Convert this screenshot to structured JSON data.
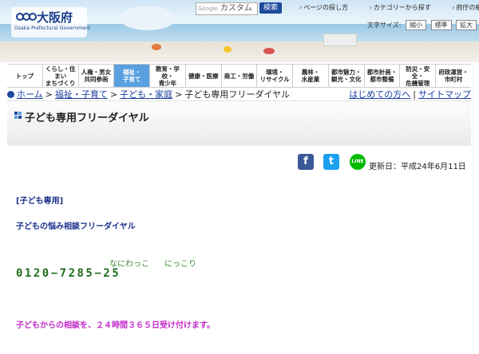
{
  "header": {
    "logo_title": "大阪府",
    "logo_subtitle": "Osaka Prefectural Government",
    "search": {
      "google_label": "Google",
      "placeholder": "カスタム",
      "button": "検索"
    },
    "util_links": [
      "ページの探し方",
      "カテゴリーから探す",
      "府庁の組織から探す"
    ],
    "font_size": {
      "label": "文字サイズ:",
      "small": "縮小",
      "normal": "標準",
      "large": "拡大"
    }
  },
  "nav": {
    "items": [
      "トップ",
      "くらし・住まい\nまちづくり",
      "人権・男女\n共同参画",
      "福祉・\n子育て",
      "教育・学校・\n青少年",
      "健康・医療",
      "商工・労働",
      "環境・\nリサイクル",
      "農林・\n水産業",
      "都市魅力・\n観光・文化",
      "都市計画・\n都市整備",
      "防災・安全・\n危機管理",
      "府政運営・\n市町村"
    ],
    "active_index": 3
  },
  "breadcrumb": {
    "home": "ホーム",
    "items": [
      "福祉・子育て",
      "子ども・家庭"
    ],
    "current": "子ども専用フリーダイヤル",
    "right_links": [
      "はじめての方へ",
      "サイトマップ"
    ]
  },
  "page_title": "子ども専用フリーダイヤル",
  "social": {
    "facebook": "f",
    "twitter": "t",
    "line": "LINE"
  },
  "updated": "更新日：平成24年6月11日",
  "content": {
    "category": "[子ども専用]",
    "heading": "子どもの悩み相談フリーダイヤル",
    "ruby_1": "なにわっこ",
    "ruby_2": "にっこり",
    "phone": "0120−7285−25",
    "note": "子どもからの相談を、２４時間３６５日受け付けます。"
  },
  "colors": {
    "brand": "#1e4a9c",
    "nav_active": "#5aa0e0",
    "link": "#1a3ea0",
    "content_text": "#1a2f8c",
    "phone": "#1e6e1e",
    "note": "#c22bc9"
  }
}
